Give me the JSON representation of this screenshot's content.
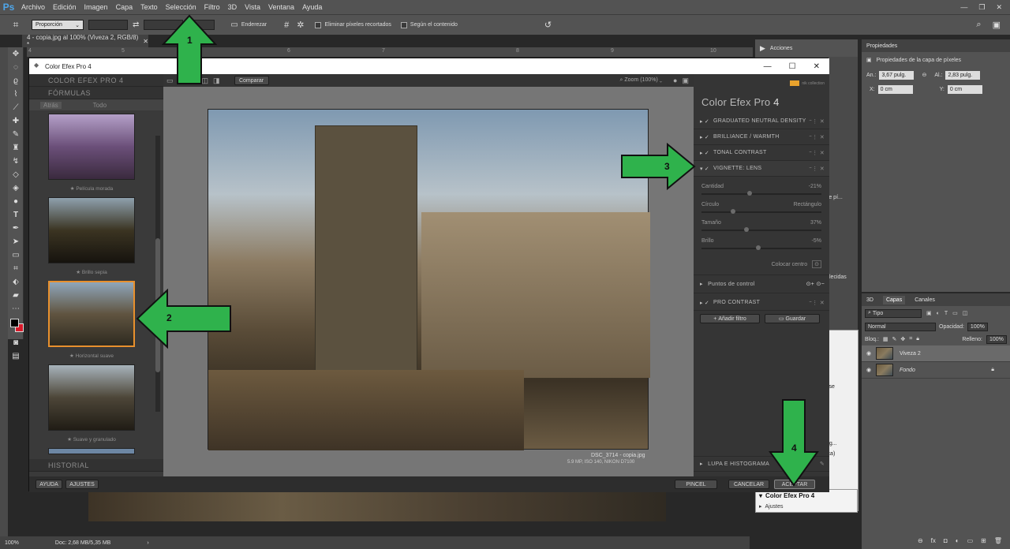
{
  "ps": {
    "logo": "Ps",
    "menu": [
      "Archivo",
      "Edición",
      "Imagen",
      "Capa",
      "Texto",
      "Selección",
      "Filtro",
      "3D",
      "Vista",
      "Ventana",
      "Ayuda"
    ],
    "options": {
      "ratio": "Proporción",
      "straighten": "Enderezar",
      "delete_cropped": "Eliminar píxeles recortados",
      "content_aware": "Según el contenido"
    },
    "doc_tab": "4 - copia.jpg al 100% (Viveza 2, RGB/8) *",
    "ruler_ticks": [
      "4",
      "5",
      "6",
      "7",
      "8",
      "9",
      "10"
    ],
    "status": {
      "zoom": "100%",
      "doc": "Doc: 2,68 MB/5,35 MB"
    }
  },
  "panels": {
    "acciones": {
      "title": "Acciones",
      "partial1": "s de pí...",
      "partial2": "lecidas",
      "partial3": "ag...",
      "partial4": "ica)",
      "partial5": "ise"
    },
    "acciones_bottom": {
      "item": "Color Efex Pro 4",
      "sub": "Ajustes"
    },
    "propiedades": {
      "title": "Propiedades",
      "subtitle": "Propiedades de la capa de píxeles",
      "an_label": "An.:",
      "an_val": "3,67 pulg.",
      "al_label": "Al.:",
      "al_val": "2,83 pulg.",
      "x_label": "X:",
      "x_val": "0 cm",
      "y_label": "Y:",
      "y_val": "0 cm"
    },
    "capas": {
      "tabs": [
        "3D",
        "Capas",
        "Canales"
      ],
      "kind": "Tipo",
      "blend": "Normal",
      "opacity_label": "Opacidad:",
      "opacity": "100%",
      "lock_label": "Bloq.:",
      "fill_label": "Relleno:",
      "fill": "100%",
      "layers": [
        {
          "name": "Viveza 2"
        },
        {
          "name": "Fondo"
        }
      ]
    }
  },
  "cef": {
    "title": "Color Efex Pro 4",
    "left": {
      "section1": "COLOR EFEX PRO 4",
      "section2": "FÓRMULAS",
      "back": "Atrás",
      "all": "Todo",
      "presets": [
        "Película morada",
        "Brillo sepia",
        "Horizontal suave",
        "Suave y granulado"
      ],
      "history": "HISTORIAL",
      "help": "AYUDA",
      "settings": "AJUSTES"
    },
    "center": {
      "compare": "Comparar",
      "zoom": "Zoom (100%)",
      "file": "DSC_3714 - copia.jpg",
      "meta": "5.9 MP, ISO 140, NIKON D7100"
    },
    "right": {
      "brand": "nik collection",
      "title": "Color Efex Pro",
      "version": "4",
      "filters": [
        "GRADUATED NEUTRAL DENSITY",
        "BRILLIANCE / WARMTH",
        "TONAL CONTRAST",
        "VIGNETTE: LENS"
      ],
      "sliders": [
        {
          "label": "Cantidad",
          "value": "-21%",
          "pos": 0.4
        },
        {
          "label": "Círculo",
          "value": "Rectángulo",
          "pos": 0.25
        },
        {
          "label": "Tamaño",
          "value": "37%",
          "pos": 0.37
        },
        {
          "label": "Brillo",
          "value": "-5%",
          "pos": 0.47
        }
      ],
      "place_center": "Colocar centro",
      "control_points": "Puntos de control",
      "pro_contrast": "PRO CONTRAST",
      "add_filter": "Añadir filtro",
      "save": "Guardar",
      "loupe": "LUPA E HISTOGRAMA"
    },
    "bottom": {
      "brush": "PINCEL",
      "cancel": "CANCELAR",
      "accept": "ACEPTAR"
    }
  },
  "annotations": [
    "1",
    "2",
    "3",
    "4"
  ],
  "colors": {
    "arrow": "#2fb24c",
    "accent": "#e8902d"
  }
}
